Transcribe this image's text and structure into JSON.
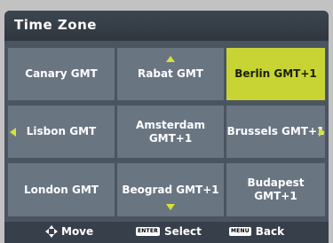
{
  "title": "Time Zone",
  "cells": [
    {
      "label": "Canary GMT",
      "selected": false
    },
    {
      "label": "Rabat GMT",
      "selected": false
    },
    {
      "label": "Berlin GMT+1",
      "selected": true
    },
    {
      "label": "Lisbon GMT",
      "selected": false
    },
    {
      "label": "Amsterdam GMT+1",
      "selected": false
    },
    {
      "label": "Brussels GMT+1",
      "selected": false
    },
    {
      "label": "London GMT",
      "selected": false
    },
    {
      "label": "Beograd GMT+1",
      "selected": false
    },
    {
      "label": "Budapest GMT+1",
      "selected": false
    }
  ],
  "footer": {
    "move_label": "Move",
    "move_icon": "dpad-icon",
    "select_key": "ENTER",
    "select_label": "Select",
    "back_key": "MENU",
    "back_label": "Back"
  },
  "colors": {
    "selected": "#c8d434",
    "cell": "#6a7582",
    "arrow": "#d9e03a",
    "title_bar": "#2f363e"
  }
}
